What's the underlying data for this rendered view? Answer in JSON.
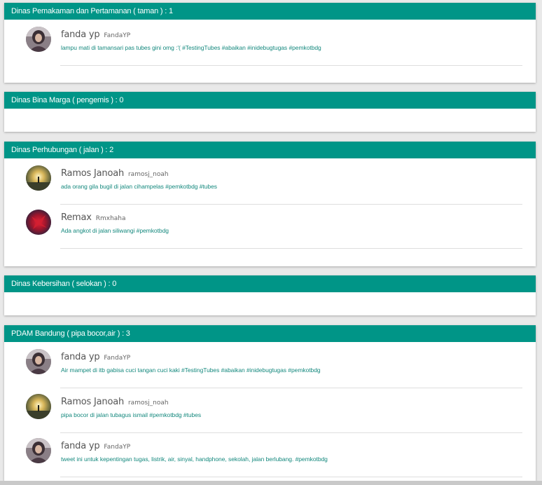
{
  "colors": {
    "header_bg": "#009587",
    "link_text": "#15897e",
    "page_bg": "#e9e9e9"
  },
  "panels": [
    {
      "title": "Dinas Pemakaman dan Pertamanan ( taman ) : 1",
      "tweets": [
        {
          "name": "fanda yp",
          "handle": "FandaYP",
          "avatar": "avatar-fanda",
          "text": "lampu mati di tamansari pas tubes gini omg :'( #TestingTubes #abaikan #inidebugtugas #pemkotbdg"
        }
      ]
    },
    {
      "title": "Dinas Bina Marga ( pengemis ) : 0",
      "tweets": []
    },
    {
      "title": "Dinas Perhubungan ( jalan ) : 2",
      "tweets": [
        {
          "name": "Ramos Janoah",
          "handle": "ramosj_noah",
          "avatar": "avatar-ramos",
          "text": "ada orang gila bugil di jalan cihampelas #pemkotbdg #tubes"
        },
        {
          "name": "Remax",
          "handle": "Rmxhaha",
          "avatar": "avatar-remax",
          "text": "Ada angkot di jalan siliwangi #pemkotbdg"
        }
      ]
    },
    {
      "title": "Dinas Kebersihan ( selokan ) : 0",
      "tweets": []
    },
    {
      "title": "PDAM Bandung ( pipa bocor,air ) : 3",
      "tweets": [
        {
          "name": "fanda yp",
          "handle": "FandaYP",
          "avatar": "avatar-fanda",
          "text": "Air mampet di itb gabisa cuci tangan cuci kaki #TestingTubes #abaikan #inidebugtugas #pemkotbdg"
        },
        {
          "name": "Ramos Janoah",
          "handle": "ramosj_noah",
          "avatar": "avatar-ramos",
          "text": "pipa bocor di jalan tubagus ismail #pemkotbdg #tubes"
        },
        {
          "name": "fanda yp",
          "handle": "FandaYP",
          "avatar": "avatar-fanda",
          "text": "tweet ini untuk kepentingan tugas, listrik, air, sinyal, handphone, sekolah, jalan berlubang. #pemkotbdg"
        }
      ]
    }
  ]
}
